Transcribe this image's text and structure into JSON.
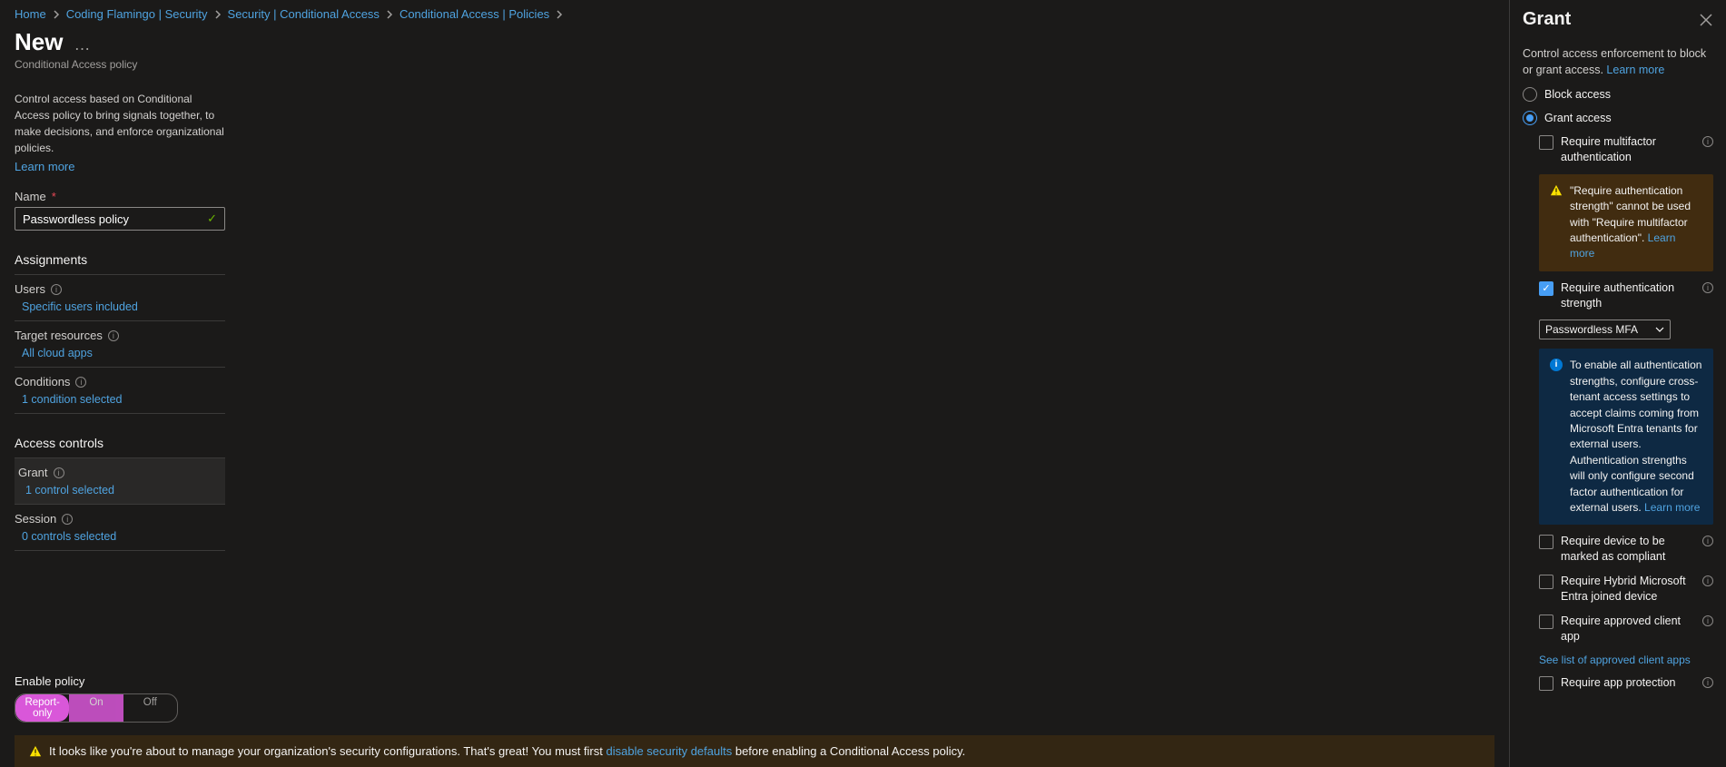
{
  "breadcrumb": [
    {
      "label": "Home"
    },
    {
      "label": "Coding Flamingo | Security"
    },
    {
      "label": "Security | Conditional Access"
    },
    {
      "label": "Conditional Access | Policies"
    }
  ],
  "page": {
    "title": "New",
    "subtitle": "Conditional Access policy",
    "intro": "Control access based on Conditional Access policy to bring signals together, to make decisions, and enforce organizational policies.",
    "learn_more": "Learn more"
  },
  "name": {
    "label": "Name",
    "value": "Passwordless policy"
  },
  "sections": {
    "assignments": "Assignments",
    "access_controls": "Access controls"
  },
  "rows": {
    "users": {
      "label": "Users",
      "link": "Specific users included"
    },
    "target": {
      "label": "Target resources",
      "link": "All cloud apps"
    },
    "conditions": {
      "label": "Conditions",
      "link": "1 condition selected"
    },
    "grant": {
      "label": "Grant",
      "link": "1 control selected"
    },
    "session": {
      "label": "Session",
      "link": "0 controls selected"
    }
  },
  "enable": {
    "label": "Enable policy",
    "opt_report": "Report-only",
    "opt_on": "On",
    "opt_off": "Off"
  },
  "warn_bar": {
    "prefix": "It looks like you're about to manage your organization's security configurations. That's great! You must first ",
    "link": "disable security defaults",
    "suffix": " before enabling a Conditional Access policy."
  },
  "panel": {
    "title": "Grant",
    "intro": "Control access enforcement to block or grant access.",
    "learn_more": "Learn more",
    "block": "Block access",
    "grant": "Grant access",
    "req_mfa": "Require multifactor authentication",
    "warn_mfa": "\"Require authentication strength\" cannot be used with \"Require multifactor authentication\".",
    "req_auth_strength": "Require authentication strength",
    "auth_strength_value": "Passwordless MFA",
    "info_auth_strength": "To enable all authentication strengths, configure cross-tenant access settings to accept claims coming from Microsoft Entra tenants for external users. Authentication strengths will only configure second factor authentication for external users.",
    "req_compliant": "Require device to be marked as compliant",
    "req_hybrid": "Require Hybrid Microsoft Entra joined device",
    "req_approved_app": "Require approved client app",
    "see_approved": "See list of approved client apps",
    "req_app_protection": "Require app protection"
  }
}
